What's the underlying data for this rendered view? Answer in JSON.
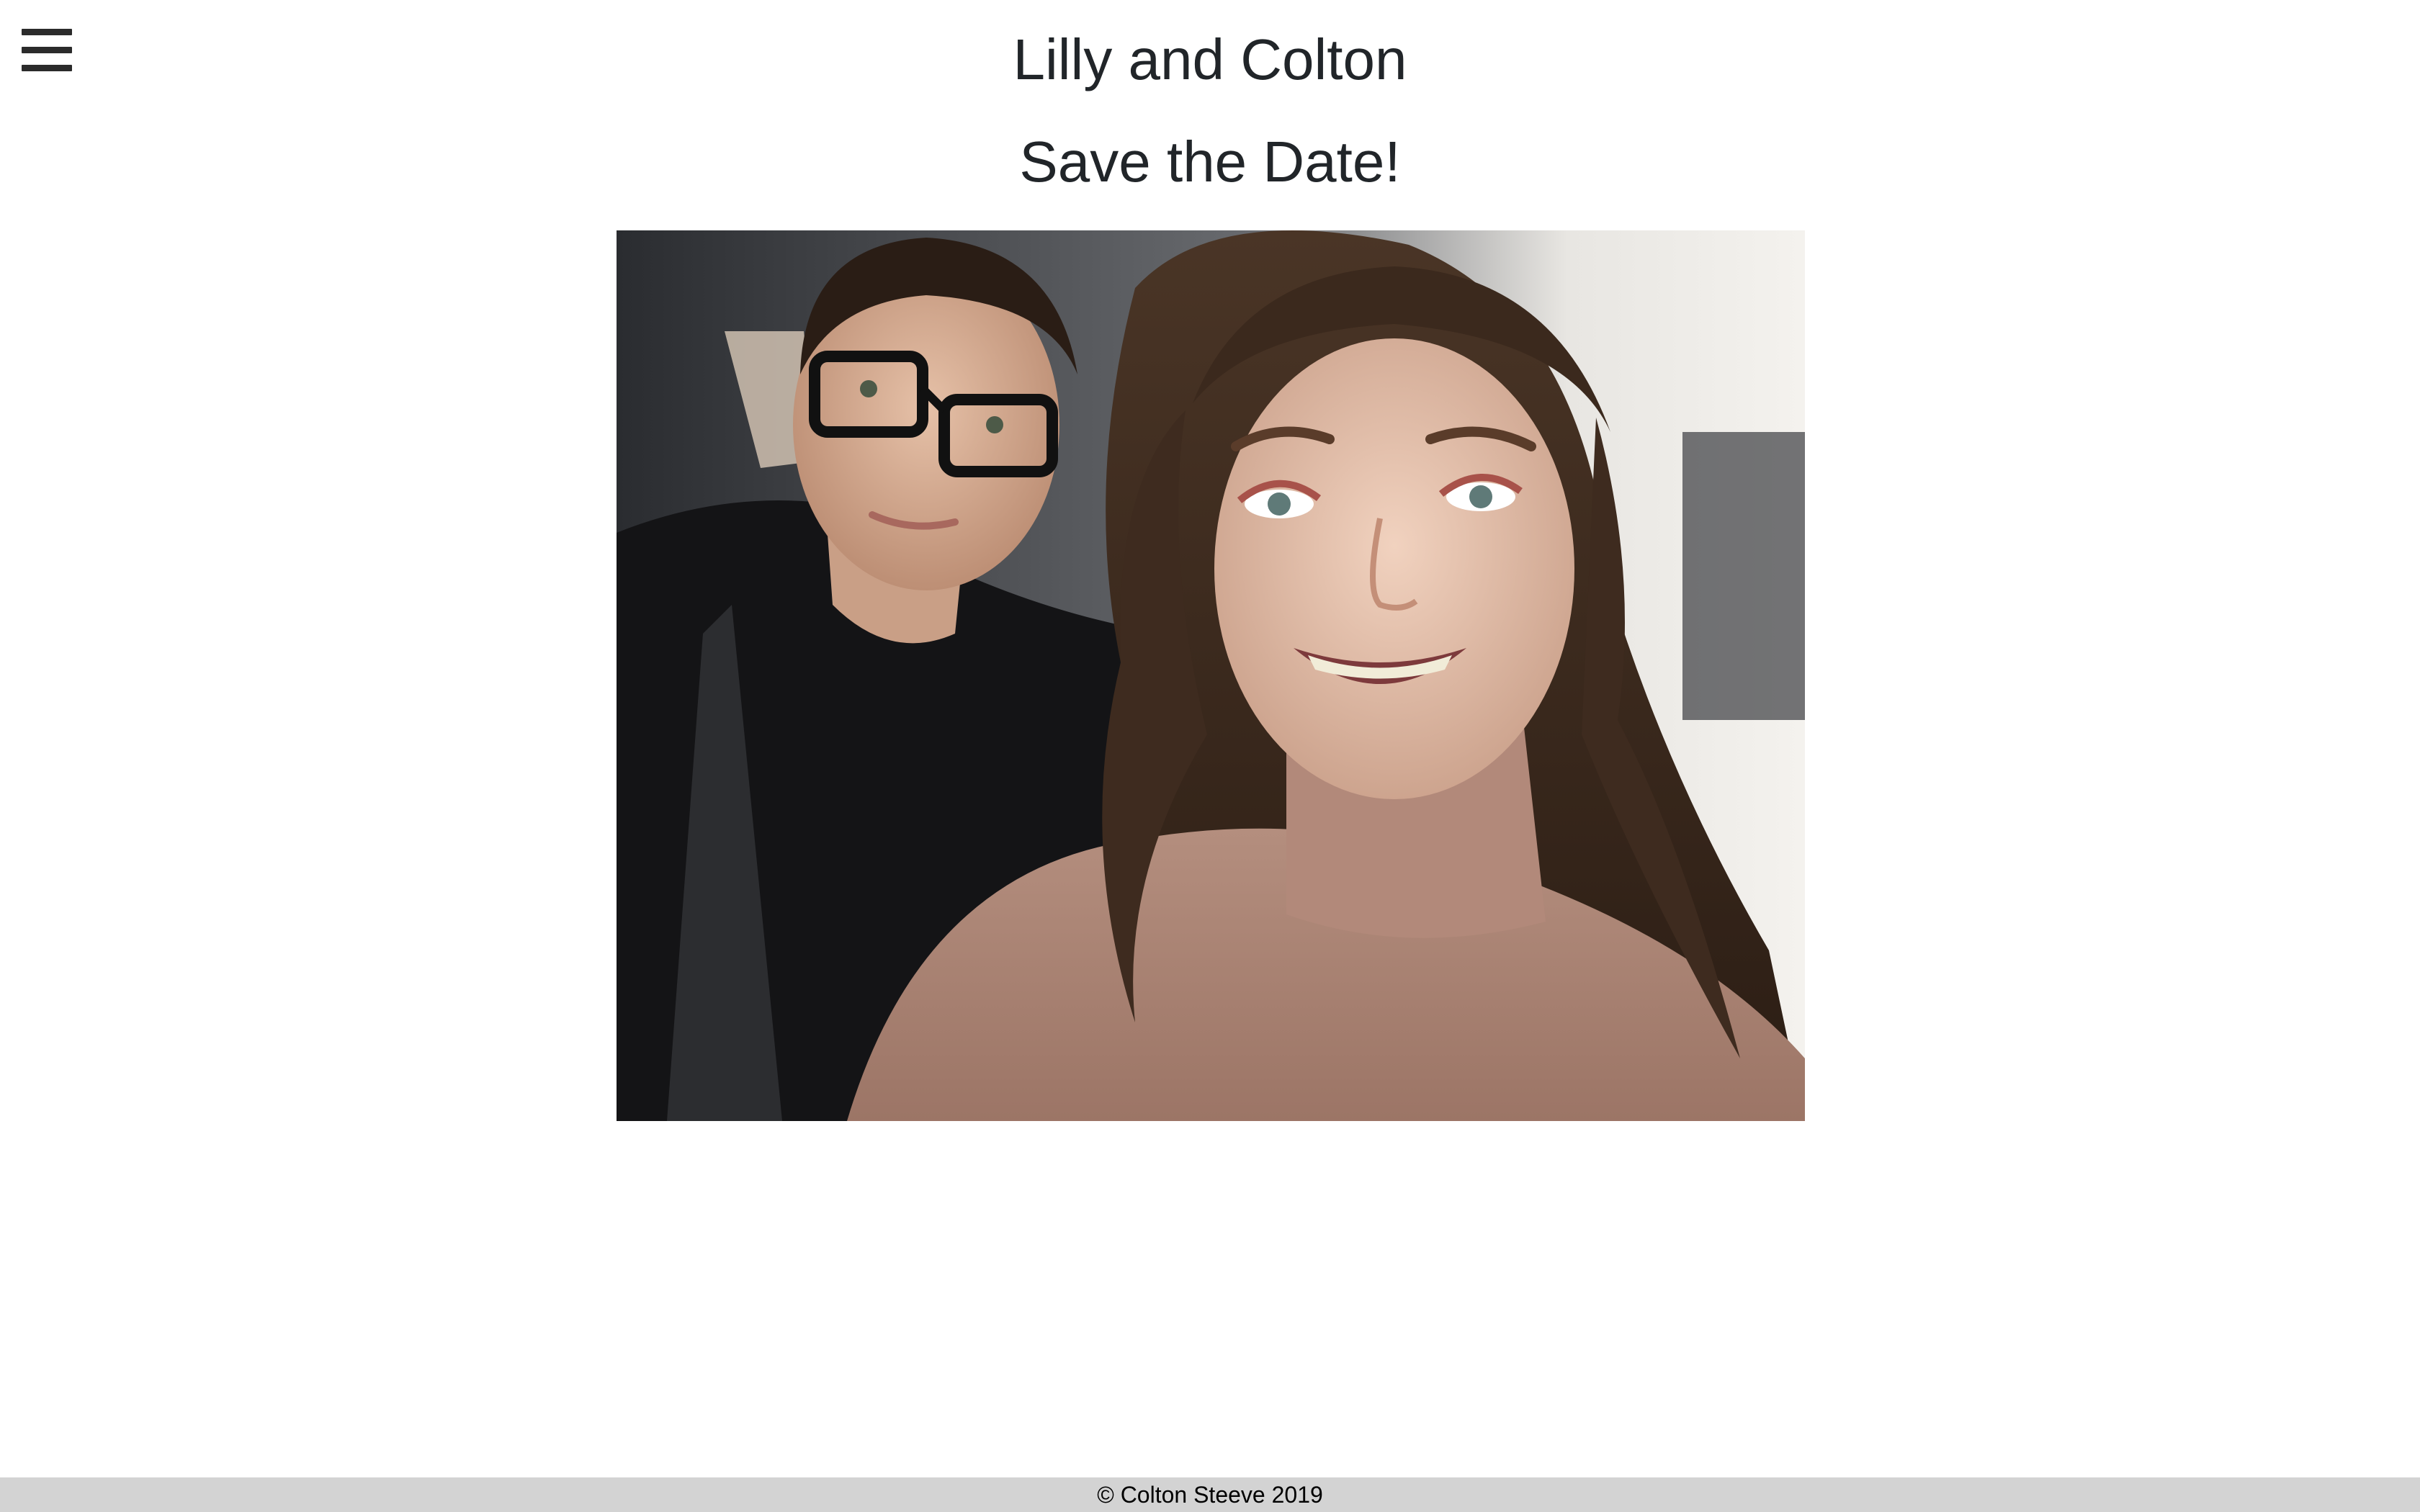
{
  "header": {
    "menu_icon": "hamburger-menu-icon",
    "title": "Lilly and Colton"
  },
  "main": {
    "subtitle": "Save the Date!",
    "photo": {
      "alt": "Couple selfie in a car"
    }
  },
  "footer": {
    "copyright": "© Colton Steeve 2019"
  },
  "colors": {
    "text": "#212529",
    "footer_bg": "#d3d3d3",
    "menu_icon": "#2b2b2b"
  }
}
